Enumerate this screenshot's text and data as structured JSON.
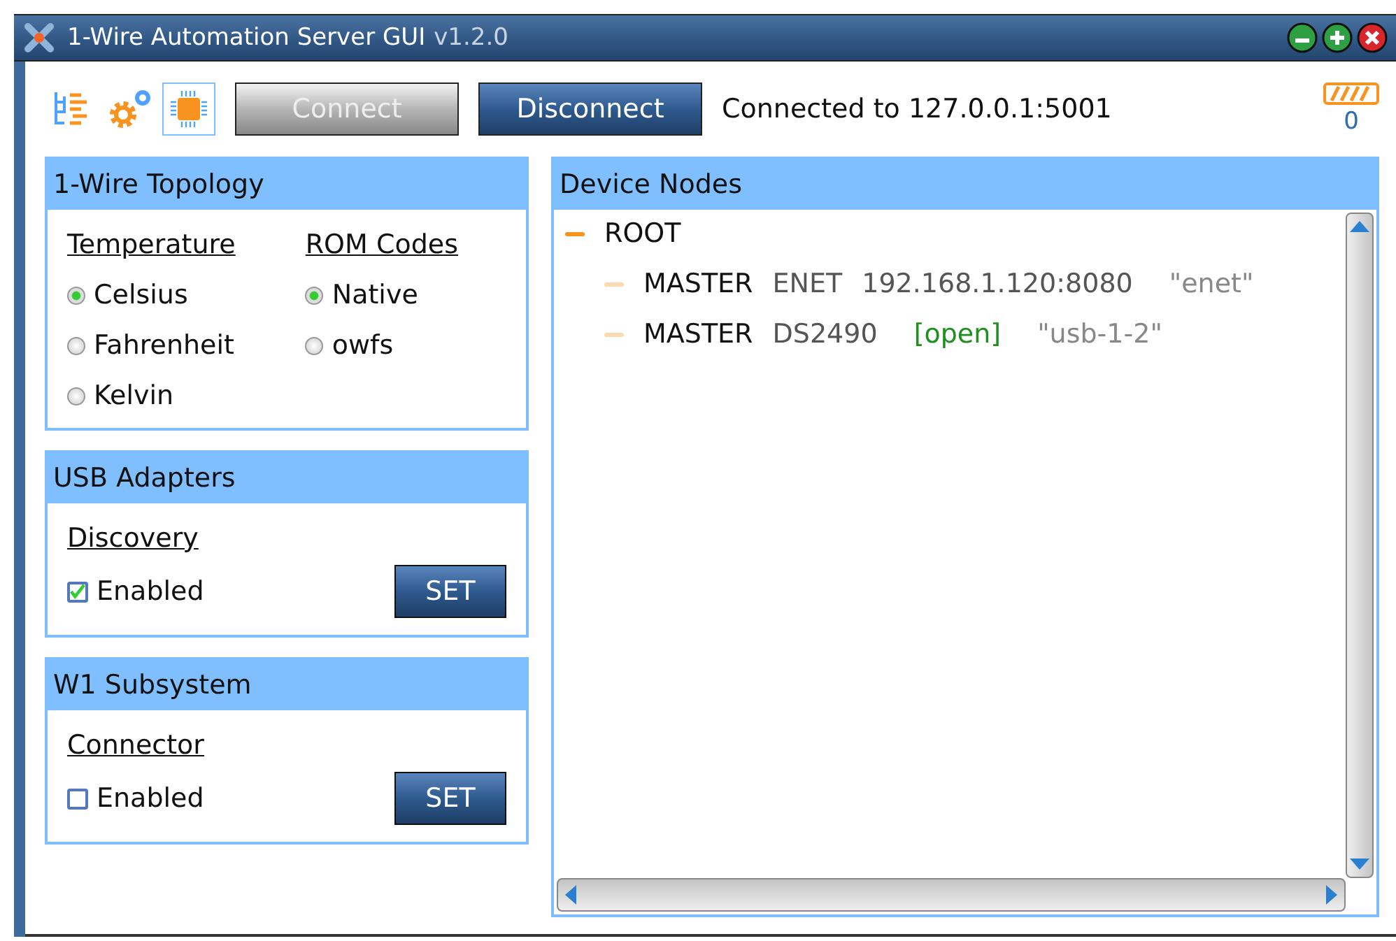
{
  "window": {
    "title": "1-Wire Automation Server GUI",
    "version": "v1.2.0"
  },
  "toolbar": {
    "icons": [
      {
        "kind": "tree",
        "selected": false
      },
      {
        "kind": "gears",
        "selected": false
      },
      {
        "kind": "chip",
        "selected": true
      }
    ],
    "buttons": [
      {
        "label": "Connect",
        "disabled": true
      },
      {
        "label": "Disconnect",
        "disabled": false
      }
    ],
    "status": "Connected to 127.0.0.1:5001",
    "counter": "0"
  },
  "topology": {
    "title": "1-Wire Topology",
    "groups": [
      {
        "heading": "Temperature",
        "options": [
          {
            "label": "Celsius",
            "selected": true
          },
          {
            "label": "Fahrenheit",
            "selected": false
          },
          {
            "label": "Kelvin",
            "selected": false
          }
        ]
      },
      {
        "heading": "ROM Codes",
        "options": [
          {
            "label": "Native",
            "selected": true
          },
          {
            "label": "owfs",
            "selected": false
          }
        ]
      }
    ]
  },
  "settings": [
    {
      "title": "USB Adapters",
      "heading": "Discovery",
      "checkbox": {
        "label": "Enabled",
        "checked": true
      },
      "button": "SET"
    },
    {
      "title": "W1 Subsystem",
      "heading": "Connector",
      "checkbox": {
        "label": "Enabled",
        "checked": false
      },
      "button": "SET"
    }
  ],
  "device_nodes": {
    "title": "Device Nodes",
    "tree": [
      {
        "parts": [
          {
            "kind": "name",
            "text": "ROOT"
          }
        ],
        "expanded": true,
        "children": [
          {
            "parts": [
              {
                "kind": "name",
                "text": "MASTER"
              },
              {
                "kind": "type",
                "text": "ENET"
              },
              {
                "kind": "type",
                "text": "192.168.1.120:8080"
              },
              {
                "kind": "alias",
                "text": "\"enet\""
              }
            ],
            "expanded": false
          },
          {
            "parts": [
              {
                "kind": "name",
                "text": "MASTER"
              },
              {
                "kind": "type",
                "text": "DS2490"
              },
              {
                "kind": "status",
                "text": "[open]"
              },
              {
                "kind": "alias",
                "text": "\"usb-1-2\""
              }
            ],
            "expanded": false
          }
        ]
      }
    ]
  }
}
